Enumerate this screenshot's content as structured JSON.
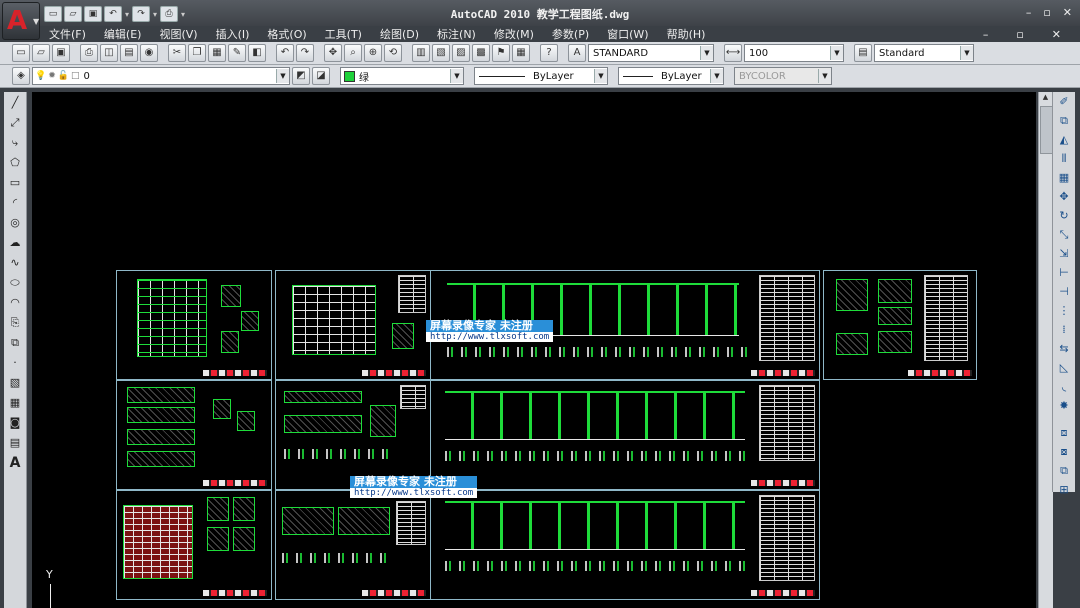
{
  "window": {
    "title": "AutoCAD 2010   教学工程图纸.dwg",
    "app_button_glyph": "A",
    "minimize": "–",
    "restore": "▫",
    "close": "✕"
  },
  "quick_access": [
    "new-icon",
    "open-icon",
    "save-icon",
    "undo-icon",
    "redo-icon",
    "plot-icon"
  ],
  "menu": {
    "items": [
      "文件(F)",
      "编辑(E)",
      "视图(V)",
      "插入(I)",
      "格式(O)",
      "工具(T)",
      "绘图(D)",
      "标注(N)",
      "修改(M)",
      "参数(P)",
      "窗口(W)",
      "帮助(H)"
    ],
    "doc_controls": [
      "–",
      "▫",
      "✕"
    ]
  },
  "toolbar1": {
    "text_style": "STANDARD",
    "dim_scale": "100",
    "table_style": "Standard"
  },
  "toolbar2": {
    "layer": "0",
    "color": "绿",
    "linetype": "ByLayer",
    "lineweight": "ByLayer",
    "plotstyle": "BYCOLOR"
  },
  "watermarks": [
    {
      "line1": "屏幕录像专家        未注册",
      "url": "http://www.tlxsoft.com"
    },
    {
      "line1": "屏幕录像专家        未注册",
      "url": "http://www.tlxsoft.com"
    }
  ],
  "ucs": {
    "y_label": "Y"
  },
  "colors": {
    "canvas": "#000000",
    "sheet_border": "#8fb8c8",
    "drawing_green": "#1edc3a",
    "drawing_red": "#7a1212",
    "watermark_blue": "#2a8fd8"
  }
}
